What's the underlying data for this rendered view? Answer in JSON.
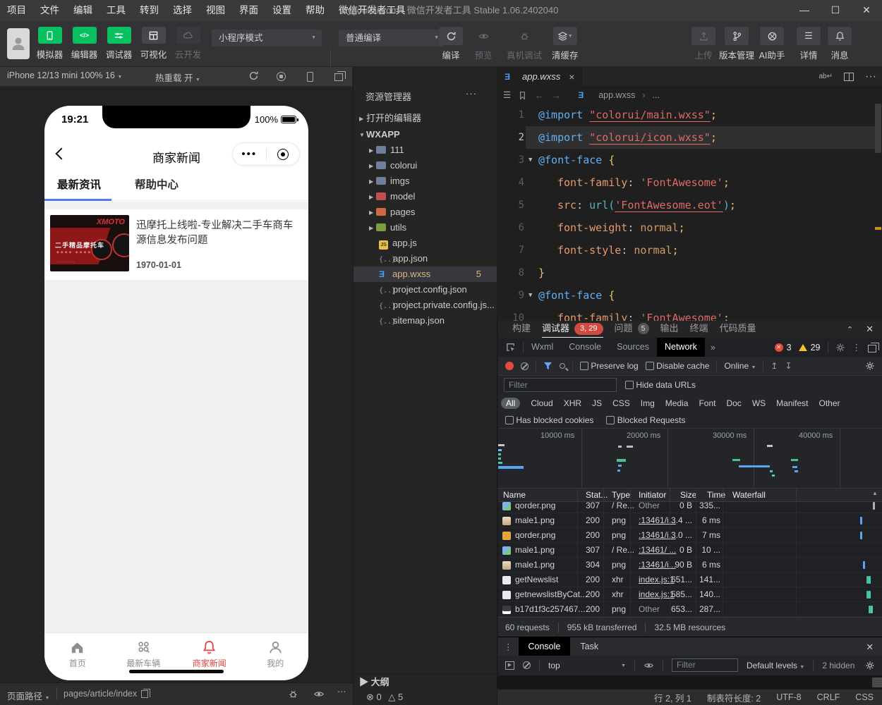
{
  "titlebar": {
    "menus": [
      "项目",
      "文件",
      "编辑",
      "工具",
      "转到",
      "选择",
      "视图",
      "界面",
      "设置",
      "帮助",
      "微信开发者工具"
    ],
    "title": "bygoukai.com - 微信开发者工具 Stable 1.06.2402040",
    "controls": {
      "minimize": "—",
      "maximize": "☐",
      "close": "✕"
    }
  },
  "toolbar": {
    "big_buttons": [
      {
        "label": "模拟器",
        "icon": "phone-icon",
        "style": "green"
      },
      {
        "label": "编辑器",
        "icon": "code-icon",
        "style": "green"
      },
      {
        "label": "调试器",
        "icon": "tune-icon",
        "style": "green"
      },
      {
        "label": "可视化",
        "icon": "layout-icon",
        "style": "gray"
      },
      {
        "label": "云开发",
        "icon": "cloud-icon",
        "style": "disabled"
      }
    ],
    "mode_select": "小程序模式",
    "compile_select": "普通编译",
    "actions": [
      {
        "label": "编译",
        "icon": "reload-icon",
        "disabled": false,
        "selected": true
      },
      {
        "label": "预览",
        "icon": "eye-icon",
        "disabled": true,
        "selected": false
      },
      {
        "label": "真机调试",
        "icon": "bug-icon",
        "disabled": true,
        "selected": false
      },
      {
        "label": "清缓存",
        "icon": "layers-icon",
        "disabled": false,
        "selected": true,
        "caret": true
      }
    ],
    "right_actions": [
      {
        "label": "上传",
        "icon": "upload-icon",
        "disabled": true
      },
      {
        "label": "版本管理",
        "icon": "branch-icon",
        "disabled": false
      },
      {
        "label": "AI助手",
        "icon": "ai-icon",
        "disabled": false
      },
      {
        "label": "详情",
        "icon": "details-icon",
        "disabled": false
      },
      {
        "label": "消息",
        "icon": "bell-icon",
        "disabled": false
      }
    ]
  },
  "simulator": {
    "device_select": "iPhone 12/13 mini 100% 16",
    "hot_reload": "热重载 开",
    "phone": {
      "time": "19:21",
      "battery": "100%",
      "nav_title": "商家新闻",
      "tabs": [
        {
          "label": "最新资讯",
          "active": true
        },
        {
          "label": "帮助中心",
          "active": false
        }
      ],
      "article": {
        "title": "迅摩托上线啦-专业解决二手车商车源信息发布问题",
        "date": "1970-01-01",
        "thumb_brand": "XMOTO",
        "thumb_caption": "二手精品摩托车"
      },
      "tabbar": [
        {
          "label": "首页",
          "icon": "home-icon",
          "active": false
        },
        {
          "label": "最新车辆",
          "icon": "vehicles-icon",
          "active": false
        },
        {
          "label": "商家新闻",
          "icon": "bell-icon",
          "active": true
        },
        {
          "label": "我的",
          "icon": "user-icon",
          "active": false
        }
      ]
    },
    "footer": {
      "path_label": "页面路径",
      "path": "pages/article/index"
    }
  },
  "explorer": {
    "title": "资源管理器",
    "open_editors": "打开的编辑器",
    "root": "WXAPP",
    "items": [
      {
        "label": "111",
        "icon": "folder",
        "color": "#6d7f99"
      },
      {
        "label": "colorui",
        "icon": "folder",
        "color": "#6d7f99"
      },
      {
        "label": "imgs",
        "icon": "folder",
        "color": "#6d7f99"
      },
      {
        "label": "model",
        "icon": "folder",
        "color": "#c0504d"
      },
      {
        "label": "pages",
        "icon": "folder",
        "color": "#cf6844"
      },
      {
        "label": "utils",
        "icon": "folder",
        "color": "#7a9e3b"
      },
      {
        "label": "app.js",
        "icon": "js"
      },
      {
        "label": "app.json",
        "icon": "json"
      },
      {
        "label": "app.wxss",
        "icon": "wxss",
        "selected": true,
        "badge": "5"
      },
      {
        "label": "project.config.json",
        "icon": "json"
      },
      {
        "label": "project.private.config.js...",
        "icon": "json"
      },
      {
        "label": "sitemap.json",
        "icon": "json"
      }
    ],
    "outline": "大纲",
    "errors": "0",
    "warnings": "5"
  },
  "editor": {
    "tab": "app.wxss",
    "breadcrumb_file": "app.wxss",
    "breadcrumb_more": "...",
    "lines": [
      {
        "num": "1",
        "fold": false,
        "current": false,
        "indent": 0,
        "tokens": [
          [
            "kw",
            "@import"
          ],
          [
            "cl",
            " "
          ],
          [
            "stru",
            "\"colorui/main.wxss\""
          ],
          [
            "pn",
            ";"
          ]
        ]
      },
      {
        "num": "2",
        "fold": false,
        "current": true,
        "indent": 0,
        "tokens": [
          [
            "kw",
            "@import"
          ],
          [
            "cl",
            " "
          ],
          [
            "stru",
            "\"colorui/icon.wxss\""
          ],
          [
            "pn",
            ";"
          ]
        ]
      },
      {
        "num": "3",
        "fold": true,
        "current": false,
        "indent": 0,
        "tokens": [
          [
            "kw",
            "@font-face"
          ],
          [
            "cl",
            " "
          ],
          [
            "br",
            "{"
          ]
        ]
      },
      {
        "num": "4",
        "fold": false,
        "current": false,
        "indent": 1,
        "tokens": [
          [
            "pr",
            "font-family"
          ],
          [
            "cl",
            ": "
          ],
          [
            "str",
            "'FontAwesome'"
          ],
          [
            "pn",
            ";"
          ]
        ]
      },
      {
        "num": "5",
        "fold": false,
        "current": false,
        "indent": 1,
        "tokens": [
          [
            "pr",
            "src"
          ],
          [
            "cl",
            ": "
          ],
          [
            "fn",
            "url("
          ],
          [
            "stru",
            "'FontAwesome.eot'"
          ],
          [
            "fn",
            ")"
          ],
          [
            "pn",
            ";"
          ]
        ]
      },
      {
        "num": "6",
        "fold": false,
        "current": false,
        "indent": 1,
        "tokens": [
          [
            "pr",
            "font-weight"
          ],
          [
            "cl",
            ": "
          ],
          [
            "vl",
            "normal"
          ],
          [
            "pn",
            ";"
          ]
        ]
      },
      {
        "num": "7",
        "fold": false,
        "current": false,
        "indent": 1,
        "tokens": [
          [
            "pr",
            "font-style"
          ],
          [
            "cl",
            ": "
          ],
          [
            "vl",
            "normal"
          ],
          [
            "pn",
            ";"
          ]
        ]
      },
      {
        "num": "8",
        "fold": false,
        "current": false,
        "indent": 0,
        "tokens": [
          [
            "br",
            "}"
          ]
        ]
      },
      {
        "num": "9",
        "fold": true,
        "current": false,
        "indent": 0,
        "tokens": [
          [
            "kw",
            "@font-face"
          ],
          [
            "cl",
            " "
          ],
          [
            "br",
            "{"
          ]
        ]
      },
      {
        "num": "10",
        "fold": false,
        "current": false,
        "indent": 1,
        "tokens": [
          [
            "pr",
            "font-family"
          ],
          [
            "cl",
            ": "
          ],
          [
            "str",
            "'FontAwesome'"
          ],
          [
            "pn",
            ";"
          ]
        ]
      }
    ]
  },
  "debugger": {
    "panel_tabs": [
      {
        "label": "构建"
      },
      {
        "label": "调试器",
        "active": true,
        "badge": "3, 29",
        "badge_style": "red"
      },
      {
        "label": "问题",
        "badge": "5",
        "badge_style": "gray"
      },
      {
        "label": "输出"
      },
      {
        "label": "终端"
      },
      {
        "label": "代码质量"
      }
    ],
    "collapse_label": "⌃",
    "close_label": "✕",
    "devtools_tabs": [
      {
        "label": "Wxml"
      },
      {
        "label": "Console"
      },
      {
        "label": "Sources"
      },
      {
        "label": "Network",
        "active": true
      }
    ],
    "more_tabs": "»",
    "error_count": "3",
    "warning_count": "29",
    "network": {
      "preserve_log": "Preserve log",
      "disable_cache": "Disable cache",
      "throttle": "Online",
      "filter_placeholder": "Filter",
      "hide_data_urls": "Hide data URLs",
      "type_filters": [
        "All",
        "Cloud",
        "XHR",
        "JS",
        "CSS",
        "Img",
        "Media",
        "Font",
        "Doc",
        "WS",
        "Manifest",
        "Other"
      ],
      "blocked_filters": [
        "Has blocked cookies",
        "Blocked Requests"
      ],
      "timeline_labels": [
        "10000 ms",
        "20000 ms",
        "30000 ms",
        "40000 ms"
      ],
      "columns": [
        "Name",
        "Stat...",
        "Type",
        "Initiator",
        "Size",
        "Time",
        "Waterfall"
      ],
      "rows": [
        {
          "name": "qorder.png",
          "icon": "image-file",
          "status": "307",
          "type": "/ Re...",
          "initiator": "Other",
          "link": false,
          "size": "0 B",
          "time": "335...",
          "tick": "gray"
        },
        {
          "name": "male1.png",
          "icon": "thumb-tan",
          "status": "200",
          "type": "png",
          "initiator": ":13461/i...",
          "link": true,
          "size": "3.4 ...",
          "time": "6 ms",
          "tick": "blue"
        },
        {
          "name": "qorder.png",
          "icon": "thumb-orange",
          "status": "200",
          "type": "png",
          "initiator": ":13461/i...",
          "link": true,
          "size": "3.0 ...",
          "time": "7 ms",
          "tick": "blue"
        },
        {
          "name": "male1.png",
          "icon": "image-file",
          "status": "307",
          "type": "/ Re...",
          "initiator": ":13461/ ...",
          "link": true,
          "size": "0 B",
          "time": "10 ...",
          "tick": "none"
        },
        {
          "name": "male1.png",
          "icon": "thumb-tan",
          "status": "304",
          "type": "png",
          "initiator": ":13461/i...",
          "link": true,
          "size": "90 B",
          "time": "6 ms",
          "tick": "blue"
        },
        {
          "name": "getNewslist",
          "icon": "doc-file",
          "status": "200",
          "type": "xhr",
          "initiator": "index.js:1",
          "link": true,
          "size": "651...",
          "time": "141...",
          "tick": "teal"
        },
        {
          "name": "getnewslistByCat...",
          "icon": "doc-file",
          "status": "200",
          "type": "xhr",
          "initiator": "index.js:1",
          "link": true,
          "size": "585...",
          "time": "140...",
          "tick": "teal"
        },
        {
          "name": "b17d1f3c257467...",
          "icon": "dark-file",
          "status": "200",
          "type": "png",
          "initiator": "Other",
          "link": false,
          "size": "653...",
          "time": "287...",
          "tick": "teal"
        }
      ],
      "summary": [
        "60 requests",
        "955 kB transferred",
        "32.5 MB resources"
      ]
    },
    "console_drawer": {
      "tabs": [
        {
          "label": "Console",
          "active": true
        },
        {
          "label": "Task",
          "active": false
        }
      ],
      "context": "top",
      "filter_placeholder": "Filter",
      "levels": "Default levels",
      "hidden_count": "2 hidden"
    }
  },
  "statusbar": {
    "items": [
      "行 2, 列 1",
      "制表符长度: 2",
      "UTF-8",
      "CRLF",
      "CSS"
    ]
  },
  "colors": {
    "wechat_green": "#07c160",
    "accent_blue": "#4a7bf7",
    "active_red": "#e64340",
    "badge_red": "#cf4a43",
    "modified_gold": "#d7ba7d"
  }
}
